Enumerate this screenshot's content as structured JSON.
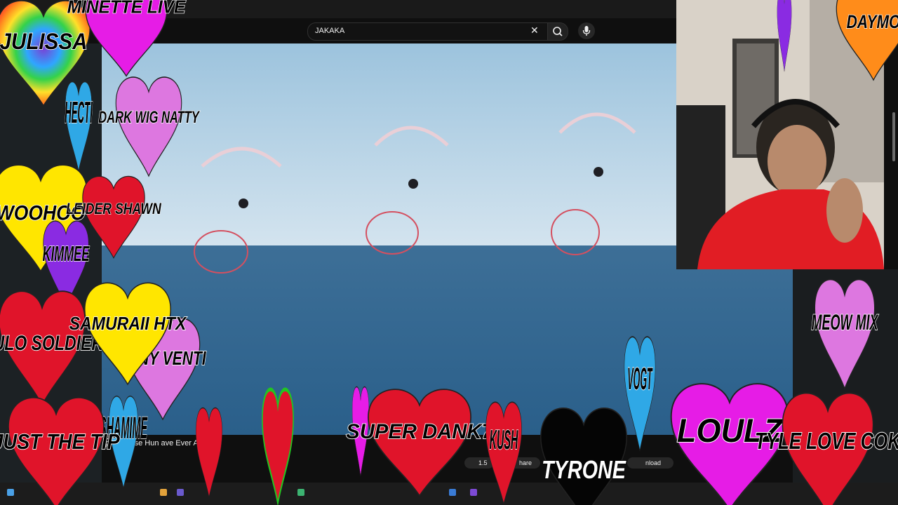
{
  "search": {
    "query": "JAKAKA"
  },
  "video": {
    "title": "ple Course Hun     ave Ever A      d",
    "likes": "1.5",
    "share_label": "hare",
    "download_label": "nload"
  },
  "hearts": [
    "JULISSA",
    "MINETTE LIVE",
    "DARK WIG NATTY",
    "HECTI",
    "WOOHOO",
    "LEIDER SHAWN",
    "KIMMEE",
    "KULO SOLDIER",
    "SAMURAII HTX",
    "TANY VENTI",
    "JUST THE TIP",
    "SHAMIME",
    "SUPER DANK7",
    "KUSH",
    "TYRONE",
    "VOGT",
    "LOULZ",
    "TYLE LOVE COK",
    "MEOW MIX",
    "DAYMO"
  ],
  "colors": {
    "youtube_bg": "#0f0f0f",
    "red_heart": "#e0142a",
    "pink_heart": "#dd55dd",
    "yellow_heart": "#ffe600"
  }
}
